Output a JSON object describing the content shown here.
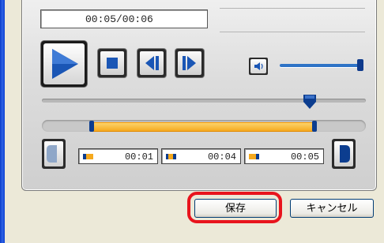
{
  "player": {
    "time_display": "00:05/00:06",
    "volume_level": 1.0,
    "seek_position_fraction": 0.86,
    "selection_start_fraction": 0.15,
    "selection_end_fraction": 0.86
  },
  "time_fields": [
    {
      "value": "00:01"
    },
    {
      "value": "00:04"
    },
    {
      "value": "00:05"
    }
  ],
  "buttons": {
    "save": "保存",
    "cancel": "キャンセル"
  },
  "colors": {
    "accent_blue": "#1a56b5",
    "selection_orange": "#f5a91e",
    "highlight_red": "#e8141d"
  },
  "icons": {
    "play": "play-icon",
    "stop": "stop-icon",
    "prev_frame": "step-back-icon",
    "next_frame": "step-forward-icon",
    "volume": "speaker-icon",
    "mark_in": "mark-in-icon",
    "mark_out": "mark-out-icon"
  }
}
